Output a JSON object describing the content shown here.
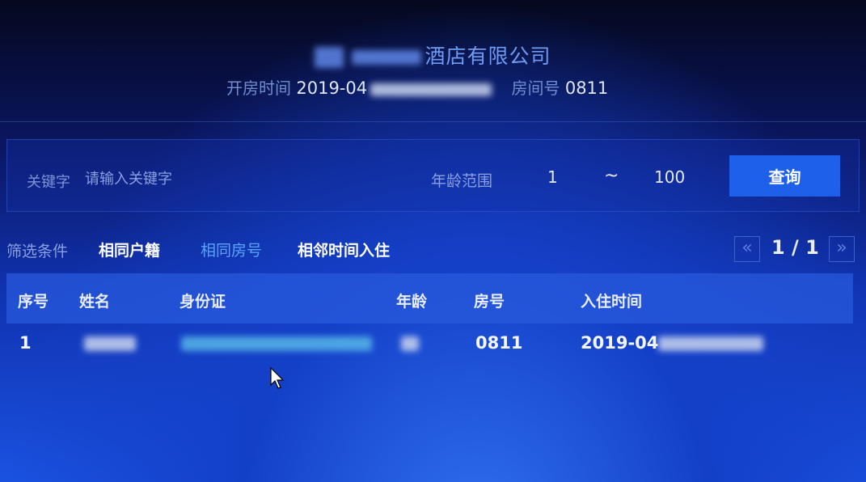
{
  "header": {
    "company_suffix": "酒店有限公司",
    "checkin_label": "开房时间",
    "checkin_value": "2019-04",
    "room_label": "房间号",
    "room_value": "0811"
  },
  "search": {
    "keyword_label": "关键字",
    "keyword_placeholder": "请输入关键字",
    "age_label": "年龄范围",
    "age_min": "1",
    "age_separator": "~",
    "age_max": "100",
    "query_button": "查询"
  },
  "filters": {
    "label": "筛选条件",
    "options": [
      "相同户籍",
      "相同房号",
      "相邻时间入住"
    ]
  },
  "pager": {
    "prev": "«",
    "text": "1 / 1",
    "next": "»"
  },
  "table": {
    "columns": [
      "序号",
      "姓名",
      "身份证",
      "年龄",
      "房号",
      "入住时间"
    ],
    "rows": [
      {
        "index": "1",
        "room": "0811",
        "checkin": "2019-04"
      }
    ]
  }
}
